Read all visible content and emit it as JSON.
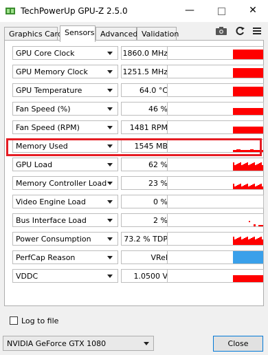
{
  "window": {
    "title": "TechPowerUp GPU-Z 2.5.0",
    "minimize_glyph": "—",
    "close_glyph": "✕"
  },
  "tabs": [
    {
      "label": "Graphics Card",
      "active": false
    },
    {
      "label": "Sensors",
      "active": true
    },
    {
      "label": "Advanced",
      "active": false
    },
    {
      "label": "Validation",
      "active": false
    }
  ],
  "toolbar_icons": [
    "camera-icon",
    "refresh-icon",
    "menu-icon"
  ],
  "sensors": [
    {
      "label": "GPU Core Clock",
      "value": "1860.0 MHz",
      "graph": "bar-top"
    },
    {
      "label": "GPU Memory Clock",
      "value": "1251.5 MHz",
      "graph": "bar-top"
    },
    {
      "label": "GPU Temperature",
      "value": "64.0 °C",
      "graph": "bar-top"
    },
    {
      "label": "Fan Speed (%)",
      "value": "46 %",
      "graph": "bar-mid"
    },
    {
      "label": "Fan Speed (RPM)",
      "value": "1481 RPM",
      "graph": "bar-mid"
    },
    {
      "label": "Memory Used",
      "value": "1545 MB",
      "graph": "line-low",
      "highlighted": true
    },
    {
      "label": "GPU Load",
      "value": "62 %",
      "graph": "noisy-high"
    },
    {
      "label": "Memory Controller Load",
      "value": "23 %",
      "graph": "noisy-low"
    },
    {
      "label": "Video Engine Load",
      "value": "0 %",
      "graph": "empty"
    },
    {
      "label": "Bus Interface Load",
      "value": "2 %",
      "graph": "tiny"
    },
    {
      "label": "Power Consumption",
      "value": "73.2 % TDP",
      "graph": "noisy-high"
    },
    {
      "label": "PerfCap Reason",
      "value": "VRel",
      "graph": "blue-block"
    },
    {
      "label": "VDDC",
      "value": "1.0500 V",
      "graph": "bar-mid"
    }
  ],
  "log_to_file": {
    "label": "Log to file",
    "checked": false
  },
  "gpu_selector": {
    "selected": "NVIDIA GeForce GTX 1080"
  },
  "close_button": {
    "label": "Close"
  },
  "colors": {
    "graph_red": "#ff0000",
    "perfcap_blue": "#3aa0ea",
    "highlight": "#e51c23",
    "accent": "#0078d7"
  }
}
